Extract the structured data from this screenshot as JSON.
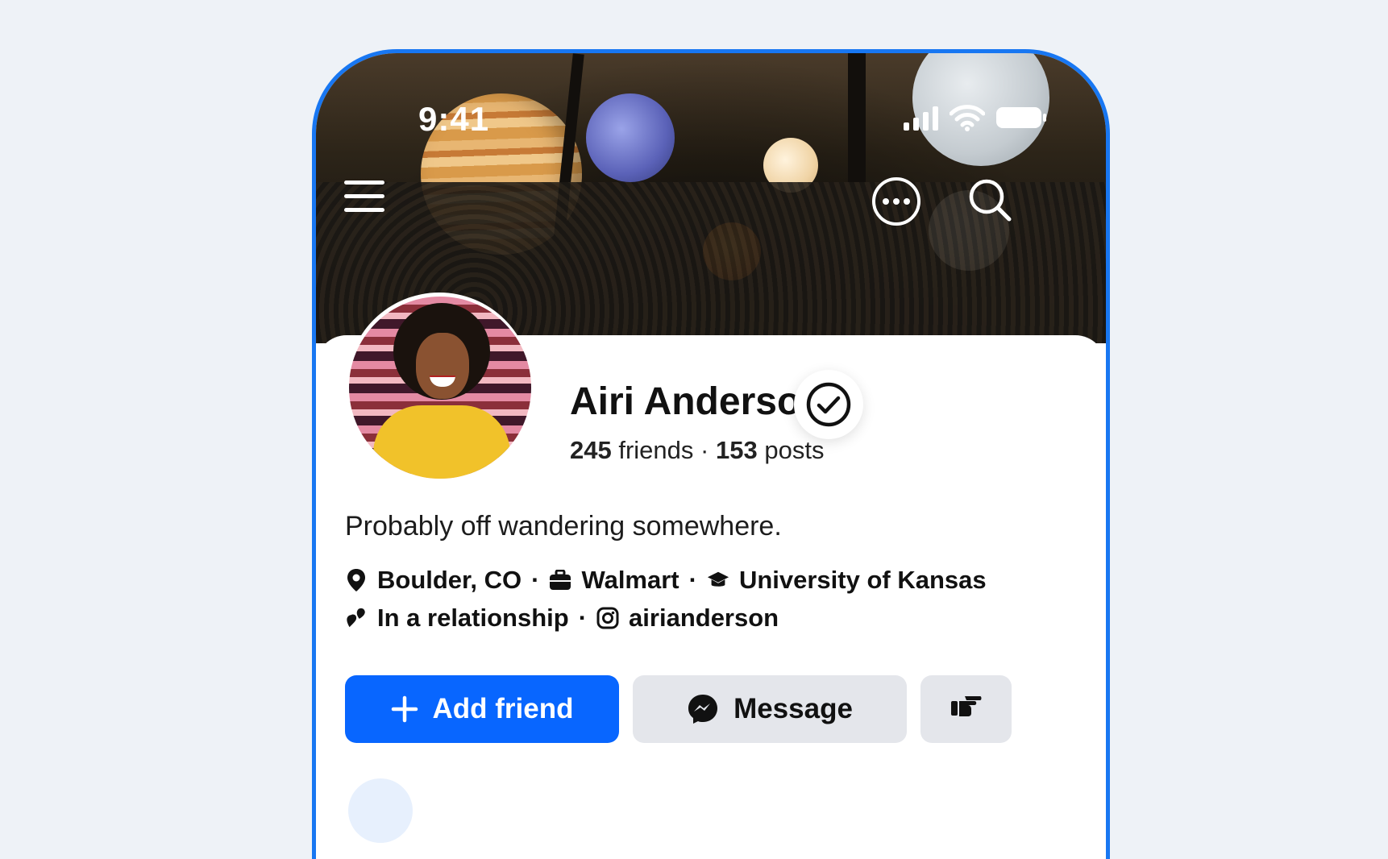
{
  "status_bar": {
    "time": "9:41"
  },
  "profile": {
    "name": "Airi Anderson",
    "friends_count": "245",
    "friends_label": "friends",
    "separator": "·",
    "posts_count": "153",
    "posts_label": "posts",
    "bio": "Probably off wandering somewhere."
  },
  "details": {
    "location": "Boulder, CO",
    "work": "Walmart",
    "education": "University of Kansas",
    "relationship": "In a relationship",
    "instagram": "airianderson",
    "dot": "·"
  },
  "actions": {
    "add_friend": "Add friend",
    "message": "Message"
  },
  "icons": {
    "menu": "menu-icon",
    "more": "more-icon",
    "search": "search-icon",
    "verified": "verified-check-icon",
    "location": "location-pin-icon",
    "work": "briefcase-icon",
    "education": "graduation-cap-icon",
    "relationship": "hearts-icon",
    "instagram": "instagram-icon",
    "add": "plus-icon",
    "messenger": "messenger-icon",
    "poke": "poke-hand-icon"
  },
  "colors": {
    "accent": "#0866ff",
    "frame": "#1877f2",
    "secondary_button": "#e4e6eb"
  }
}
